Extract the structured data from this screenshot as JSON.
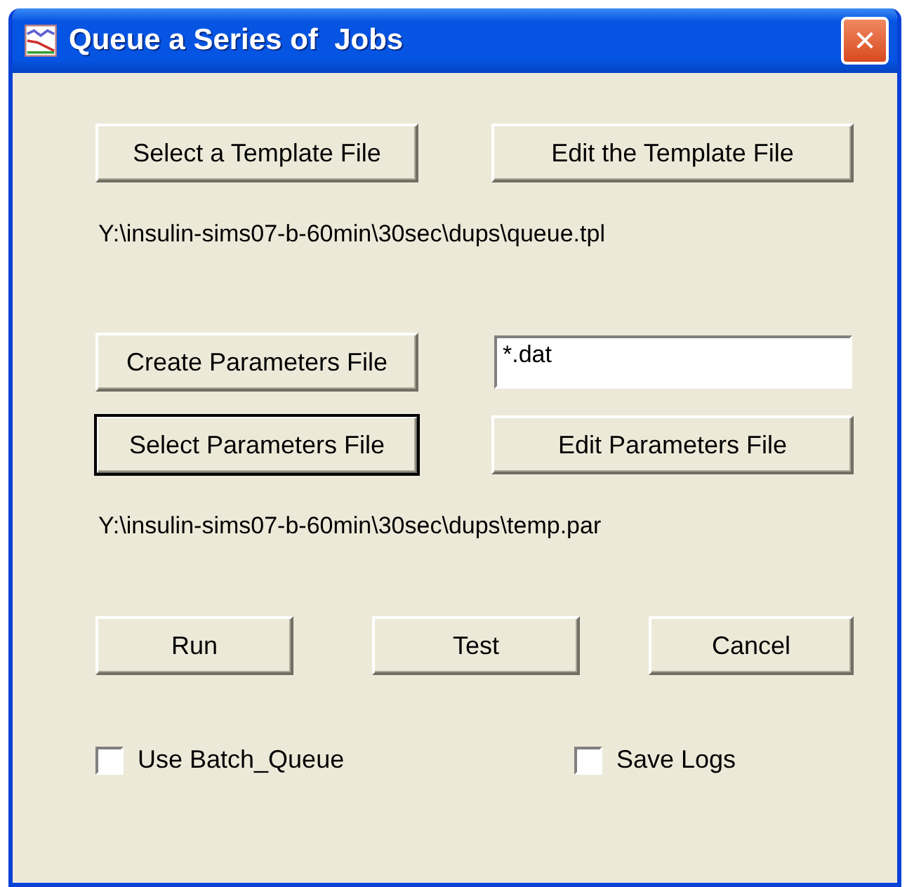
{
  "window": {
    "title": "Queue a Series of  Jobs",
    "close": "✕"
  },
  "template_buttons": [
    {
      "label": "Select a Template File",
      "focused": false
    },
    {
      "label": "Edit the Template File",
      "focused": false
    }
  ],
  "template_path": "Y:\\insulin-sims07-b-60min\\30sec\\dups\\queue.tpl",
  "create_button": {
    "label": "Create Parameters File",
    "focused": false
  },
  "pattern_field": {
    "value": "*.dat"
  },
  "parameter_buttons": [
    {
      "label": "Select Parameters File",
      "focused": true
    },
    {
      "label": "Edit Parameters File",
      "focused": false
    }
  ],
  "parameter_path": "Y:\\insulin-sims07-b-60min\\30sec\\dups\\temp.par",
  "action_buttons": [
    {
      "label": "Run",
      "focused": false
    },
    {
      "label": "Test",
      "focused": false
    },
    {
      "label": "Cancel",
      "focused": false
    }
  ],
  "checkboxes": [
    {
      "label": "Use Batch_Queue",
      "checked": false
    },
    {
      "label": "Save Logs",
      "checked": false
    }
  ]
}
